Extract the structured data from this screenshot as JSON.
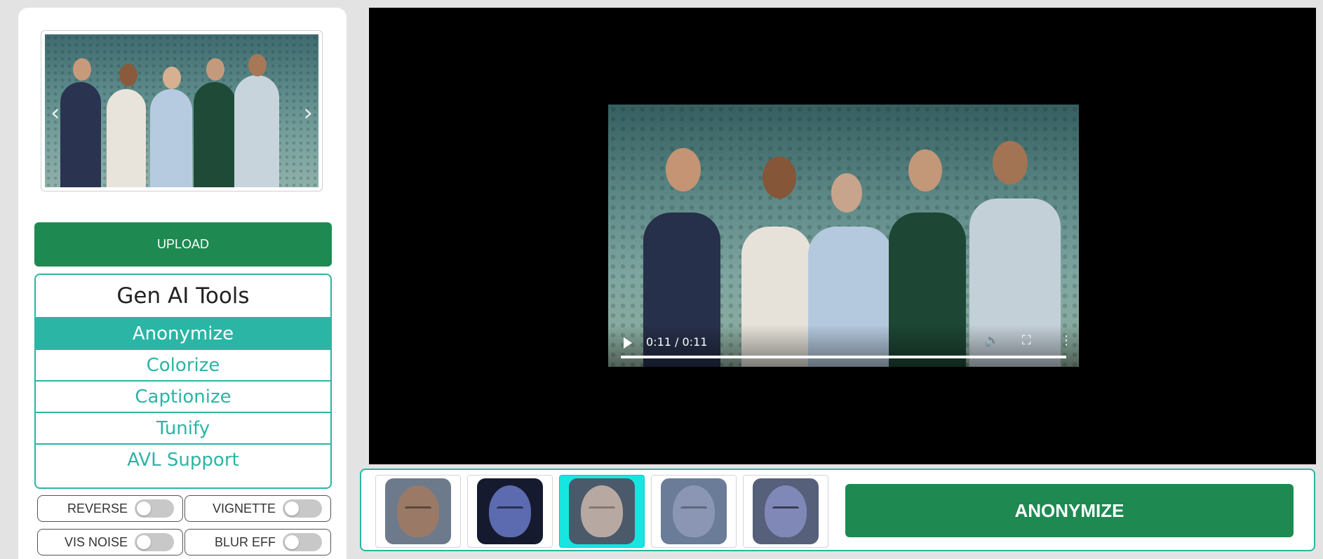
{
  "sidebar": {
    "upload_label": "UPLOAD",
    "tools_title": "Gen AI Tools",
    "tools": [
      {
        "label": "Anonymize",
        "active": true
      },
      {
        "label": "Colorize",
        "active": false
      },
      {
        "label": "Captionize",
        "active": false
      },
      {
        "label": "Tunify",
        "active": false
      },
      {
        "label": "AVL Support",
        "active": false
      }
    ],
    "toggles": [
      {
        "label": "REVERSE",
        "on": false
      },
      {
        "label": "VIGNETTE",
        "on": false
      },
      {
        "label": "VIS NOISE",
        "on": false
      },
      {
        "label": "BLUR EFF",
        "on": false
      }
    ],
    "carousel": {
      "prev_icon": "chevron-left-icon",
      "next_icon": "chevron-right-icon"
    }
  },
  "video": {
    "time": "0:11 / 0:11",
    "progress": 1.0,
    "icons": [
      "play-icon",
      "mute-icon",
      "fullscreen-icon",
      "more-options-icon"
    ]
  },
  "faces": {
    "selected_index": 2,
    "count": 5
  },
  "action": {
    "anonymize_label": "ANONYMIZE"
  },
  "colors": {
    "primary_green": "#1e8a52",
    "teal": "#2bb5a5",
    "selected_cyan": "#17e6e0"
  }
}
